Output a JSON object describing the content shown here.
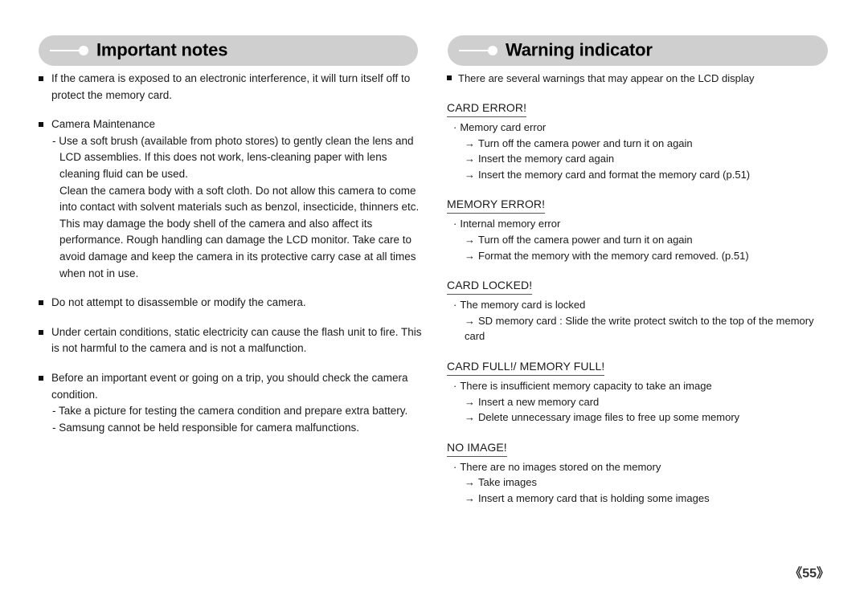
{
  "page": {
    "number_label": "《55》",
    "background_color": "#ffffff",
    "header_bar_color": "#cfcfcf"
  },
  "left_section": {
    "title": "Important notes",
    "notes": [
      {
        "bullet": "If the camera is exposed to an electronic interference, it will turn itself off to protect the memory card.",
        "sub_dash": [],
        "sub_plain": []
      },
      {
        "bullet": "Camera Maintenance",
        "sub_dash": [
          "- Use a soft brush (available from photo stores) to gently clean the lens and LCD assemblies. If this does not work, lens-cleaning paper with lens cleaning fluid can be used."
        ],
        "sub_plain": [
          "Clean the camera body with a soft cloth. Do not allow this camera to come into contact with solvent materials such as benzol, insecticide, thinners etc. This may damage the body shell of the camera and also affect its performance. Rough handling can damage the LCD monitor. Take care to avoid damage and keep the camera in its protective carry case at all times when not in use."
        ]
      },
      {
        "bullet": "Do not attempt to disassemble or modify the camera.",
        "sub_dash": [],
        "sub_plain": []
      },
      {
        "bullet": "Under certain conditions, static electricity can cause the flash unit to fire. This is not harmful to the camera and is not a malfunction.",
        "sub_dash": [],
        "sub_plain": []
      },
      {
        "bullet": "Before an important event or going on a trip, you should check the camera condition.",
        "sub_dash": [
          "- Take a picture for testing the camera condition and prepare extra battery.",
          "- Samsung cannot be held responsible for camera malfunctions."
        ],
        "sub_plain": []
      }
    ]
  },
  "right_section": {
    "title": "Warning indicator",
    "intro": "There are several warnings that may appear on the LCD display",
    "warnings": [
      {
        "title": "CARD ERROR!",
        "cause": "Memory card error",
        "actions": [
          "Turn off the camera power and turn it on again",
          "Insert the memory card again",
          "Insert the memory card and format the memory card (p.51)"
        ]
      },
      {
        "title": "MEMORY ERROR!",
        "cause": "Internal memory error",
        "actions": [
          "Turn off the camera power and turn it on again",
          "Format the memory with the memory card removed. (p.51)"
        ]
      },
      {
        "title": "CARD LOCKED!",
        "cause": "The memory card is locked",
        "actions": [
          "SD memory card : Slide the write protect switch to the top of the memory card"
        ]
      },
      {
        "title": "CARD FULL!/ MEMORY FULL!",
        "cause": "There is insufficient memory capacity to take an image",
        "actions": [
          "Insert a new memory card",
          "Delete unnecessary image files to free up some memory"
        ]
      },
      {
        "title": "NO IMAGE!",
        "cause": "There are no images stored on the memory",
        "actions": [
          "Take images",
          "Insert a memory card that is holding some images"
        ]
      }
    ],
    "markers": {
      "cause_marker": "·",
      "action_marker": "→"
    }
  }
}
